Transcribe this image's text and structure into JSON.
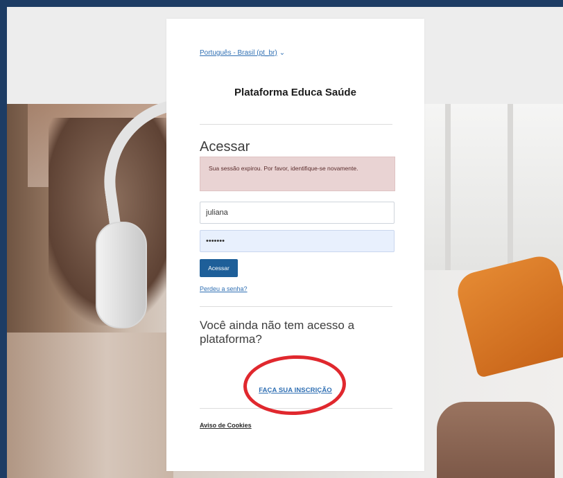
{
  "card": {
    "language_label": "Português - Brasil (pt_br)",
    "site_name": "Plataforma Educa Saúde",
    "login_heading": "Acessar",
    "alert_message": "Sua sessão expirou. Por favor, identifique-se novamente.",
    "username_value": "juliana",
    "password_value": "•••••••",
    "login_button_label": "Acessar",
    "forgot_password_label": "Perdeu a senha?",
    "signup_question": "Você ainda não tem acesso a plataforma?",
    "signup_link_label": "FAÇA SUA INSCRIÇÃO",
    "cookies_link_label": "Aviso de Cookies"
  },
  "annotation": {
    "circle_color": "#e0282e"
  },
  "colors": {
    "page_border": "#1d3c64",
    "primary_button": "#1e5f99",
    "link": "#2f6fb3",
    "alert_bg": "#e9d3d3",
    "password_field_bg": "#e8f0fd"
  },
  "icons": {
    "language_dropdown": "chevron-down-icon"
  }
}
